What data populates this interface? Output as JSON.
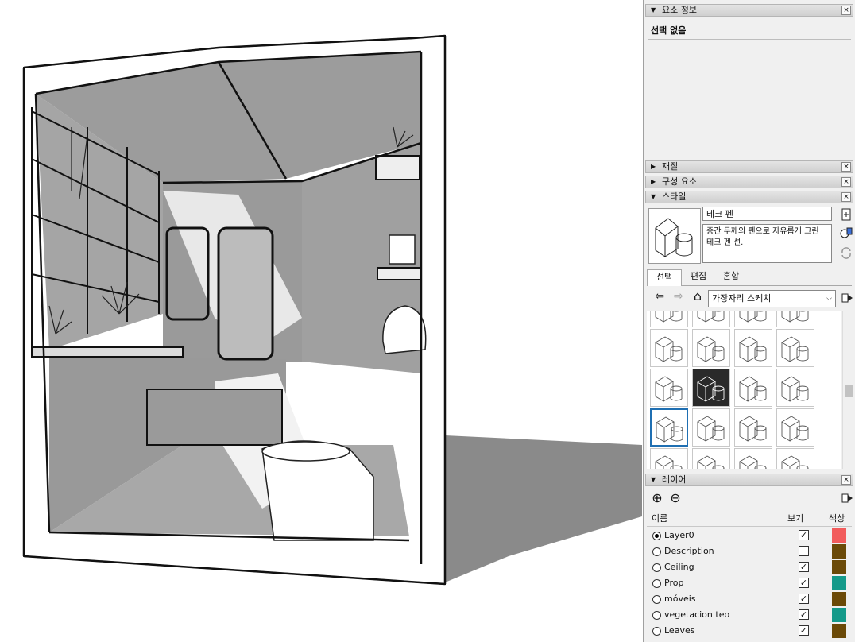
{
  "viewport": {
    "description_none": ""
  },
  "trays": {
    "entity_info": {
      "title": "요소 정보",
      "state": "expanded",
      "selection": "선택 없음"
    },
    "materials": {
      "title": "재질",
      "state": "collapsed"
    },
    "components": {
      "title": "구성 요소",
      "state": "collapsed"
    },
    "styles": {
      "title": "스타일",
      "state": "expanded",
      "style_name": "테크 펜",
      "style_description": "중간 두께의 펜으로 자유롭게 그린 테크 펜 선.",
      "tabs": [
        {
          "label": "선택",
          "active": true
        },
        {
          "label": "편집",
          "active": false
        },
        {
          "label": "혼합",
          "active": false
        }
      ],
      "collection": "가장자리 스케치"
    },
    "layers": {
      "title": "레이어",
      "state": "expanded",
      "col_name": "이름",
      "col_visible": "보기",
      "col_color": "색상",
      "rows": [
        {
          "name": "Layer0",
          "active": true,
          "visible": true,
          "color": "#f25c5c"
        },
        {
          "name": "Description",
          "active": false,
          "visible": false,
          "color": "#6b4a08"
        },
        {
          "name": "Ceiling",
          "active": false,
          "visible": true,
          "color": "#6b4a08"
        },
        {
          "name": "Prop",
          "active": false,
          "visible": true,
          "color": "#159a8a"
        },
        {
          "name": "móveis",
          "active": false,
          "visible": true,
          "color": "#6b4a08"
        },
        {
          "name": "vegetacion teo",
          "active": false,
          "visible": true,
          "color": "#159a8a"
        },
        {
          "name": "Leaves",
          "active": false,
          "visible": true,
          "color": "#6b4a08"
        }
      ]
    }
  },
  "glyphs": {
    "close": "×",
    "expanded": "▼",
    "collapsed": "▶",
    "check": "✓",
    "back": "⇦",
    "forward": "⇨",
    "home": "⌂",
    "add": "⊕",
    "remove": "⊖",
    "dropdown": "⌵"
  },
  "colors": {
    "accent_selection": "#1f6fb2",
    "panel_bg": "#f0f0f0"
  }
}
